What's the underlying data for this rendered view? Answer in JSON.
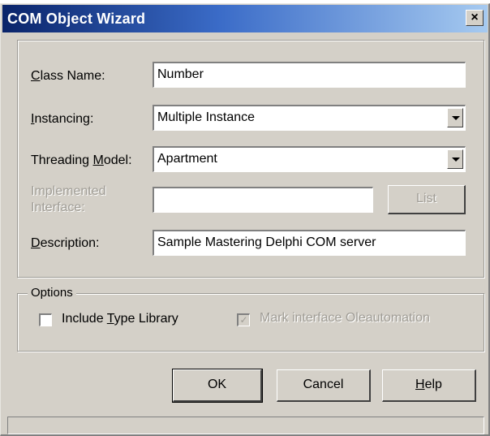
{
  "window": {
    "title": "COM Object Wizard",
    "close_glyph": "×"
  },
  "form": {
    "class_name": {
      "label_pre": "",
      "label_key": "C",
      "label_post": "lass Name:",
      "value": "Number"
    },
    "instancing": {
      "label_pre": "",
      "label_key": "I",
      "label_post": "nstancing:",
      "value": "Multiple Instance"
    },
    "threading": {
      "label_pre": "Threading ",
      "label_key": "M",
      "label_post": "odel:",
      "value": "Apartment"
    },
    "implemented": {
      "label": "Implemented Interface:",
      "value": "",
      "button": "List"
    },
    "description": {
      "label_pre": "",
      "label_key": "D",
      "label_post": "escription:",
      "value": "Sample Mastering Delphi COM server"
    }
  },
  "options": {
    "legend": "Options",
    "include_type_library": {
      "label_pre": "Include ",
      "label_key": "T",
      "label_post": "ype Library",
      "checked": false
    },
    "mark_oleautomation": {
      "label": "Mark interface Oleautomation",
      "checked": true
    }
  },
  "buttons": {
    "ok": "OK",
    "cancel": "Cancel",
    "help_key": "H",
    "help_post": "elp"
  },
  "icons": {
    "close": "close-icon",
    "dropdown": "chevron-down-icon",
    "check": "check-icon"
  }
}
